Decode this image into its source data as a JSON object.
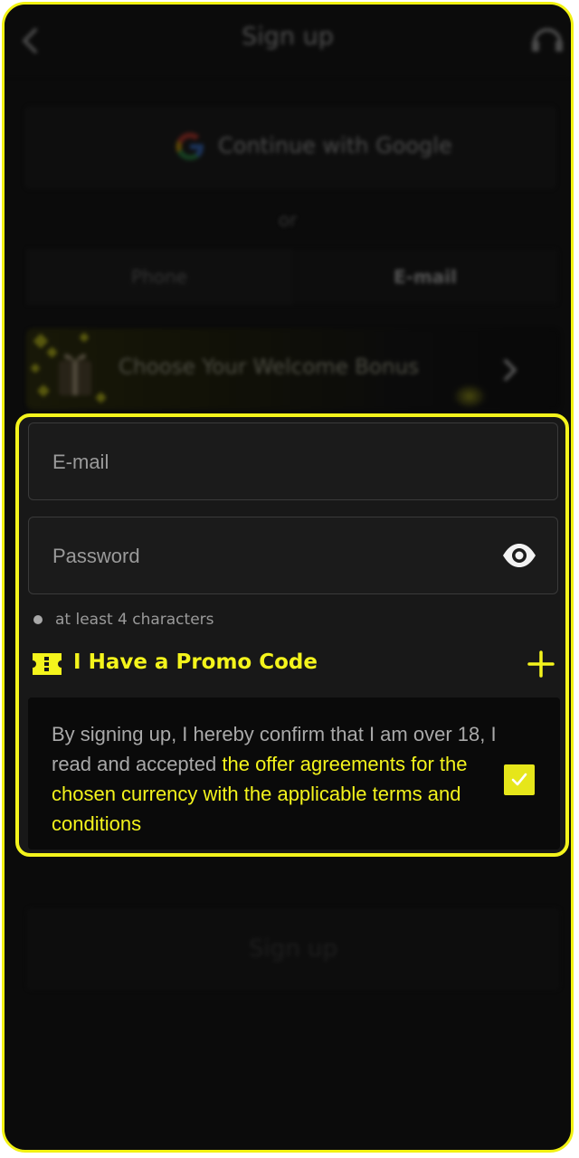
{
  "header": {
    "title": "Sign up"
  },
  "google": {
    "label": "Continue with Google"
  },
  "separator": {
    "label": "or"
  },
  "tabs": [
    {
      "label": "Phone",
      "active": false
    },
    {
      "label": "E-mail",
      "active": true
    }
  ],
  "bonus": {
    "label": "Choose Your Welcome Bonus"
  },
  "form": {
    "email": {
      "placeholder": "E-mail",
      "value": ""
    },
    "password": {
      "placeholder": "Password",
      "value": ""
    },
    "password_hint": "at least 4 characters",
    "promo_label": "I Have a Promo Code",
    "terms": {
      "text": "By signing up, I hereby confirm that I am over 18, I read and accepted ",
      "link": "the offer agreements for the chosen currency with the applicable terms and conditions",
      "checked": true
    }
  },
  "submit": {
    "label": "Sign up"
  },
  "colors": {
    "accent": "#f4f41c",
    "background": "#121212",
    "field": "#1b1b1b"
  },
  "icons": [
    "back-icon",
    "support-icon",
    "google-icon",
    "gift-icon",
    "chevron-right-icon",
    "eye-icon",
    "ticket-icon",
    "plus-icon",
    "check-icon"
  ]
}
